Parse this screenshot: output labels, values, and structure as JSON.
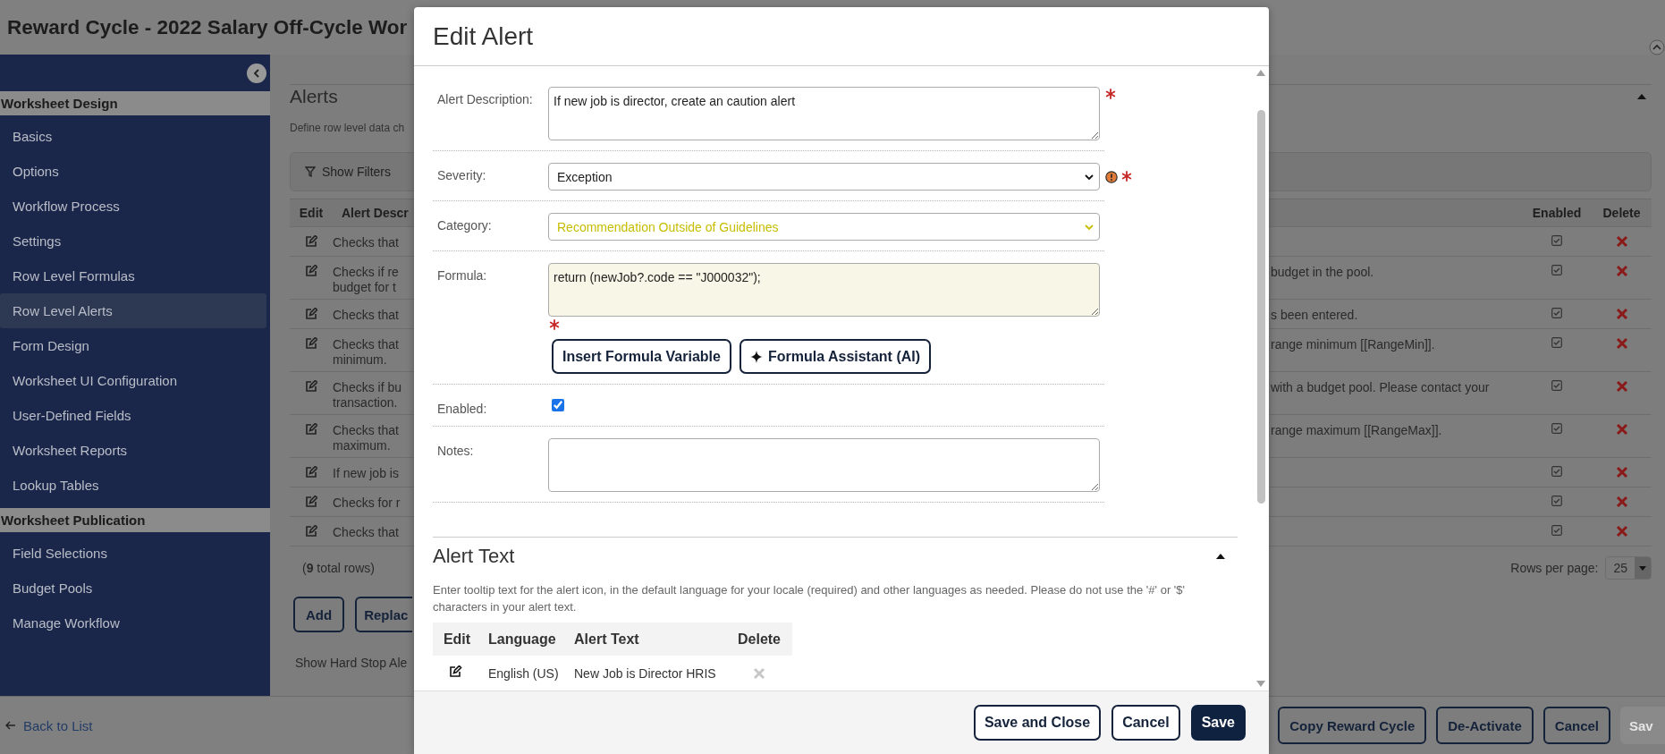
{
  "page": {
    "title": "Reward Cycle - 2022 Salary Off-Cycle Wor"
  },
  "sidebar": {
    "sections": [
      {
        "title": "Worksheet Design",
        "items": [
          {
            "label": "Basics",
            "selected": false
          },
          {
            "label": "Options",
            "selected": false
          },
          {
            "label": "Workflow Process",
            "selected": false
          },
          {
            "label": "Settings",
            "selected": false
          },
          {
            "label": "Row Level Formulas",
            "selected": false
          },
          {
            "label": "Row Level Alerts",
            "selected": true
          },
          {
            "label": "Form Design",
            "selected": false
          },
          {
            "label": "Worksheet UI Configuration",
            "selected": false
          },
          {
            "label": "User-Defined Fields",
            "selected": false
          },
          {
            "label": "Worksheet Reports",
            "selected": false
          },
          {
            "label": "Lookup Tables",
            "selected": false
          }
        ]
      },
      {
        "title": "Worksheet Publication",
        "items": [
          {
            "label": "Field Selections",
            "selected": false
          },
          {
            "label": "Budget Pools",
            "selected": false
          },
          {
            "label": "Manage Workflow",
            "selected": false
          }
        ]
      }
    ]
  },
  "alerts_panel": {
    "title": "Alerts",
    "expanded": true,
    "description": "Define row level data ch",
    "filter_button": "Show Filters",
    "columns_left": [
      "Edit",
      "Alert Descr"
    ],
    "columns_right": [
      "Enabled",
      "Delete"
    ],
    "rows": [
      {
        "description_left": "Checks that",
        "enabled": true
      },
      {
        "description_left": "Checks if re\nbudget for t",
        "description_right": "budget in the pool.",
        "enabled": true
      },
      {
        "description_left": "Checks that",
        "description_right": "s been entered.",
        "enabled": true
      },
      {
        "description_left": "Checks that\nminimum.",
        "description_right": "range minimum [[RangeMin]].",
        "enabled": true
      },
      {
        "description_left": "Checks if bu\ntransaction.",
        "description_right": "with a budget pool. Please contact your",
        "enabled": true
      },
      {
        "description_left": "Checks that\nmaximum.",
        "description_right": "range maximum [[RangeMax]].",
        "enabled": true
      },
      {
        "description_left": "If new job is",
        "enabled": true
      },
      {
        "description_left": "Checks for r",
        "enabled": true
      },
      {
        "description_left": "Checks that",
        "enabled": true
      }
    ],
    "total_rows": "(**9** total rows)",
    "rows_per_page_label": "Rows per page:",
    "rows_per_page": "25",
    "buttons": [
      "Add",
      "Replac"
    ],
    "hard_stop_label": "Show Hard Stop Ale"
  },
  "footer": {
    "back_link": "Back to List",
    "buttons": [
      {
        "label": "Copy Reward Cycle",
        "disabled": false
      },
      {
        "label": "De-Activate",
        "disabled": false
      },
      {
        "label": "Cancel",
        "disabled": false
      },
      {
        "label": "Sav",
        "disabled": true
      }
    ]
  },
  "modal": {
    "title": "Edit Alert",
    "fields": [
      {
        "kind": "textarea",
        "label": "Alert Description:",
        "value": "If new job is director, create an caution alert",
        "required": true
      },
      {
        "kind": "select",
        "label": "Severity:",
        "value": "Exception",
        "required": true,
        "warning": true
      },
      {
        "kind": "select",
        "label": "Category:",
        "value": "Recommendation Outside of Guidelines",
        "color": "#c6bd00"
      },
      {
        "kind": "formula",
        "label": "Formula:",
        "value": "return (newJob?.code == \"J000032\");",
        "required": true,
        "buttons": [
          "Insert Formula Variable",
          "Formula Assistant (AI)"
        ]
      },
      {
        "kind": "checkbox",
        "label": "Enabled:",
        "checked": true
      },
      {
        "kind": "textarea",
        "label": "Notes:"
      }
    ],
    "alert_text": {
      "title": "Alert Text",
      "expanded": true,
      "description": "Enter tooltip text for the alert icon, in the default language for your locale (required) and other languages as needed. Please do not use the '#' or '$' characters in your alert text.",
      "columns": [
        "Edit",
        "Language",
        "Alert Text",
        "Delete"
      ],
      "rows": [
        {
          "language": "English (US)",
          "text": "New Job is Director HRIS",
          "delete_disabled": true
        }
      ]
    },
    "buttons": [
      {
        "label": "Save and Close",
        "primary": false
      },
      {
        "label": "Cancel",
        "primary": false
      },
      {
        "label": "Save",
        "primary": true
      }
    ]
  }
}
